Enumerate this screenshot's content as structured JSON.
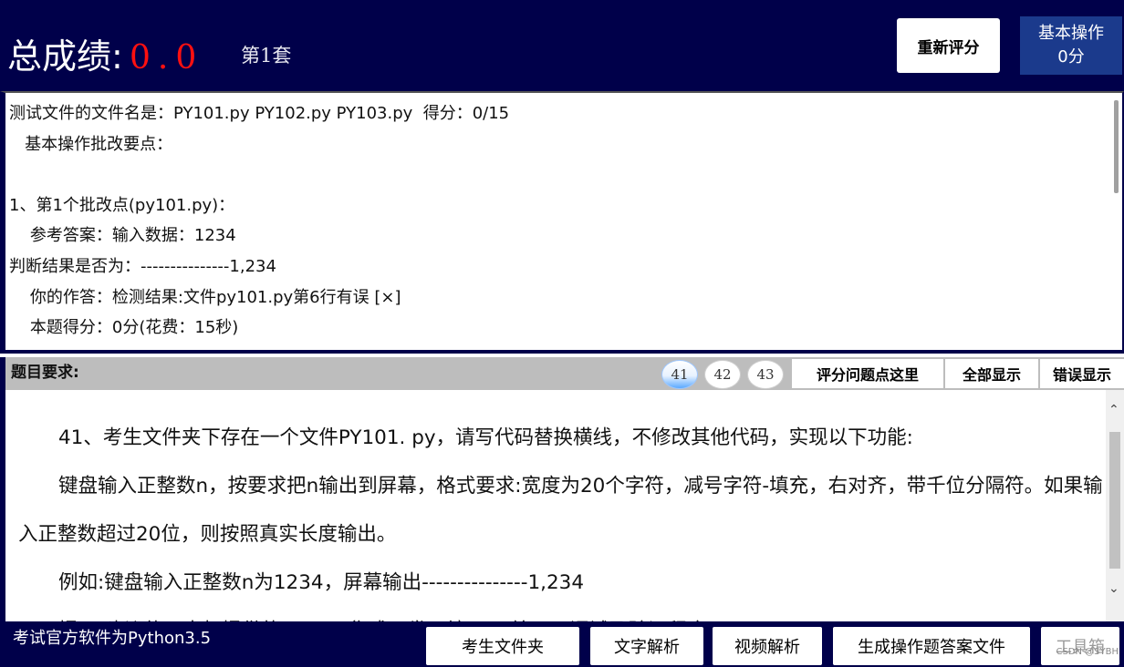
{
  "header": {
    "score_label": "总成绩:",
    "score_value": "0.0",
    "set_label": "第1套",
    "rescore_button": "重新评分",
    "basic_op_title": "基本操作",
    "basic_op_score": "0分"
  },
  "result": {
    "lines": [
      "测试文件的文件名是：PY101.py PY102.py PY103.py  得分：0/15",
      "   基本操作批改要点：",
      "",
      "1、第1个批改点(py101.py)：",
      "    参考答案：输入数据：1234",
      "判断结果是否为：---------------1,234",
      "    你的作答：检测结果:文件py101.py第6行有误 [×]",
      "    本题得分：0分(花费：15秒)"
    ]
  },
  "question_bar": {
    "title": "题目要求:",
    "numbers": [
      "41",
      "42",
      "43"
    ],
    "active_number": "41",
    "scoring_points_button": "评分问题点这里",
    "show_all_button": "全部显示",
    "show_errors_button": "错误显示"
  },
  "question": {
    "paragraphs": [
      "41、考生文件夹下存在一个文件PY101. py，请写代码替换横线，不修改其他代码，实现以下功能:",
      "键盘输入正整数n，按要求把n输出到屏幕，格式要求:宽度为20个字符，减号字符-填充，右对齐，带千位分隔符。如果输入正整数超过20位，则按照真实长度输出。",
      "例如:键盘输入正整数n为1234，屏幕输出---------------1,234",
      "提示:建议使用本机提供的Python集成开发环境IDLE编写、调试及验证程序。"
    ]
  },
  "footer": {
    "note": "考试官方软件为Python3.5",
    "buttons": {
      "folder": "考生文件夹",
      "text_analysis": "文字解析",
      "video_analysis": "视频解析",
      "generate_answers": "生成操作题答案文件",
      "toolbox": "工具箱"
    },
    "watermark": "CSDN @SYBH"
  }
}
